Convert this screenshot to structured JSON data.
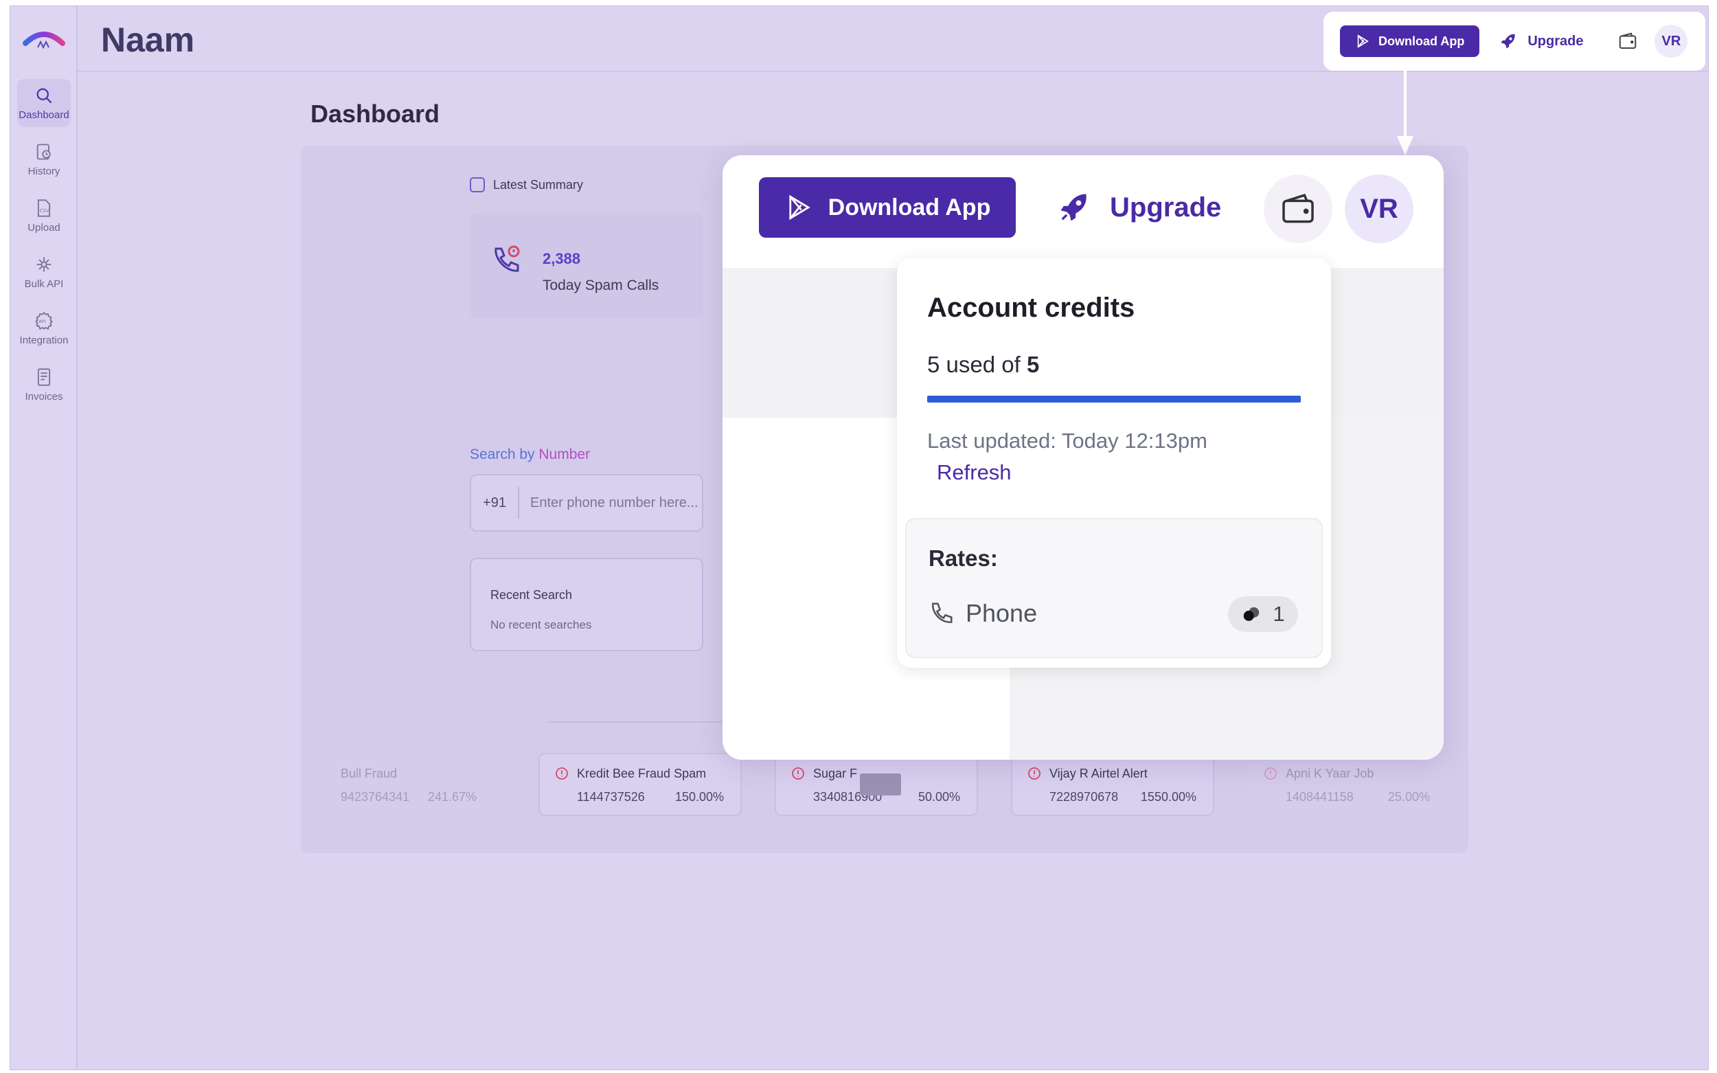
{
  "app": {
    "brand": "Naam",
    "page_title": "Dashboard"
  },
  "sidebar": {
    "items": [
      {
        "label": "Dashboard",
        "icon": "search-icon",
        "active": true
      },
      {
        "label": "History",
        "icon": "history-icon"
      },
      {
        "label": "Upload",
        "icon": "csv-icon"
      },
      {
        "label": "Bulk API",
        "icon": "bulk-api-icon"
      },
      {
        "label": "Integration",
        "icon": "api-icon"
      },
      {
        "label": "Invoices",
        "icon": "invoice-icon"
      }
    ]
  },
  "topbar": {
    "download_label": "Download App",
    "upgrade_label": "Upgrade",
    "wallet_icon": "wallet-icon",
    "avatar_initials": "VR"
  },
  "dashboard": {
    "summary_label": "Latest Summary",
    "spam_count": "2,388",
    "spam_label": "Today Spam Calls",
    "search_label_part1": "Search by ",
    "search_label_part2": "Number",
    "country_code": "+91",
    "phone_placeholder": "Enter phone number here...",
    "recent_title": "Recent Search",
    "recent_empty": "No recent searches",
    "ticker": [
      {
        "title": "Bull Fraud",
        "number": "9423764341",
        "percent": "241.67%",
        "faded": true
      },
      {
        "title": "Kredit Bee Fraud Spam",
        "number": "1144737526",
        "percent": "150.00%"
      },
      {
        "title": "Sugar F",
        "number": "3340816900",
        "percent": "50.00%"
      },
      {
        "title": "Vijay R Airtel Alert",
        "number": "7228970678",
        "percent": "1550.00%"
      },
      {
        "title": "Apni K Yaar Job",
        "number": "1408441158",
        "percent": "25.00%",
        "faded": true
      }
    ]
  },
  "zoom": {
    "download_label": "Download App",
    "upgrade_label": "Upgrade",
    "avatar_initials": "VR",
    "credits": {
      "title": "Account credits",
      "used_prefix": "5 used of ",
      "total": "5",
      "used_fraction": 1.0,
      "updated": "Last updated: Today 12:13pm",
      "refresh_label": "Refresh",
      "rates_title": "Rates:",
      "rate_item": "Phone",
      "rate_value": "1"
    }
  },
  "colors": {
    "accent": "#4a2aa6",
    "progress": "#2f5bd8",
    "overlay": "#dcd3f0"
  }
}
